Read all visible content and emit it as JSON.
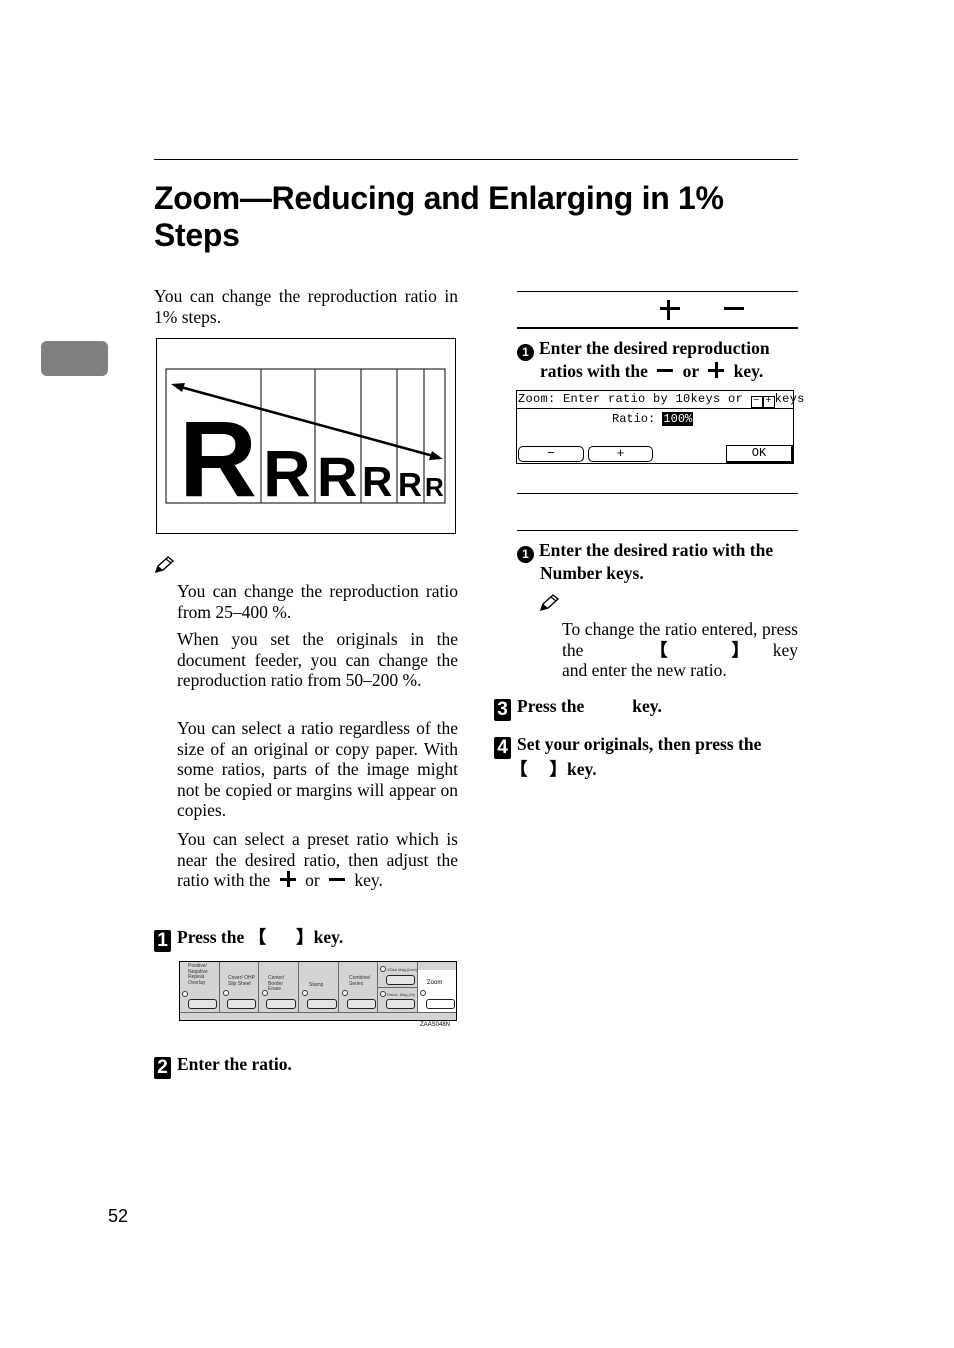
{
  "page": {
    "title_line1": "Zoom—Reducing and Enlarging in 1%",
    "title_line2": "Steps",
    "page_number": "52",
    "side_tab_color": "#808080"
  },
  "intro": {
    "text": "You can change the reproduction ratio in 1% steps."
  },
  "figure_r": {
    "letter": "R",
    "sizes_desc": [
      "largest",
      "large",
      "medium",
      "small",
      "smaller",
      "smallest"
    ],
    "arrow": "double-headed arrow"
  },
  "notes": {
    "icon": "pencil-note-icon",
    "items": [
      "You can change the reproduction ratio from 25–400 %.",
      "When you set the originals in the document feeder, you can change the reproduction ratio from 50–200 %.",
      "You can select a ratio regardless of the size of an original or copy paper. With some ratios, parts of the image might not be copied or margins will appear on copies.",
      "You can select a preset ratio which is near the desired ratio, then adjust the ratio with the"
    ],
    "last_mid": "or",
    "last_end": "key."
  },
  "steps": {
    "s1": {
      "num": "1",
      "pre": "Press the",
      "open": "【",
      "close": "】",
      "post": "key."
    },
    "s2": {
      "num": "2",
      "text": "Enter the ratio."
    },
    "s3": {
      "num": "3",
      "pre": "Press the",
      "post": "key."
    },
    "s4": {
      "num": "4",
      "text": "Set your originals, then press the",
      "open": "【",
      "close": "】",
      "post": "key."
    }
  },
  "panel": {
    "cells": [
      {
        "label": "Positive/ Negative Repeat Overlay"
      },
      {
        "label": "Cover/ OHP Slip Sheet"
      },
      {
        "label": "Center/ Border Erase"
      },
      {
        "label": "Stamp"
      },
      {
        "label": "Combine/ Series"
      },
      {
        "label_top": "1Size Mag.(inch)",
        "label_bottom": "Direct. Mag.(%)"
      },
      {
        "label": "Zoom"
      }
    ],
    "code": "ZAAS048N"
  },
  "right": {
    "header_plus": "+",
    "header_minus": "−",
    "sub1": {
      "num": "1",
      "line1": "Enter the desired reproduction",
      "line2_pre": "ratios with the",
      "line2_mid": "or",
      "line2_post": "key."
    },
    "lcd": {
      "top_line": "Zoom:  Enter ratio by 10keys or",
      "top_suffix": "keys",
      "ratio_label": "Ratio:",
      "ratio_value": "100%",
      "minus_btn": "−",
      "plus_btn": "+",
      "ok_btn": "OK"
    },
    "sub2": {
      "num": "1",
      "line1": "Enter the desired ratio with the",
      "line2": "Number keys."
    },
    "note": {
      "pre": "To change the ratio entered, press the",
      "open": "【",
      "close": "】",
      "post1": "key",
      "line3": "and enter the new ratio."
    }
  }
}
